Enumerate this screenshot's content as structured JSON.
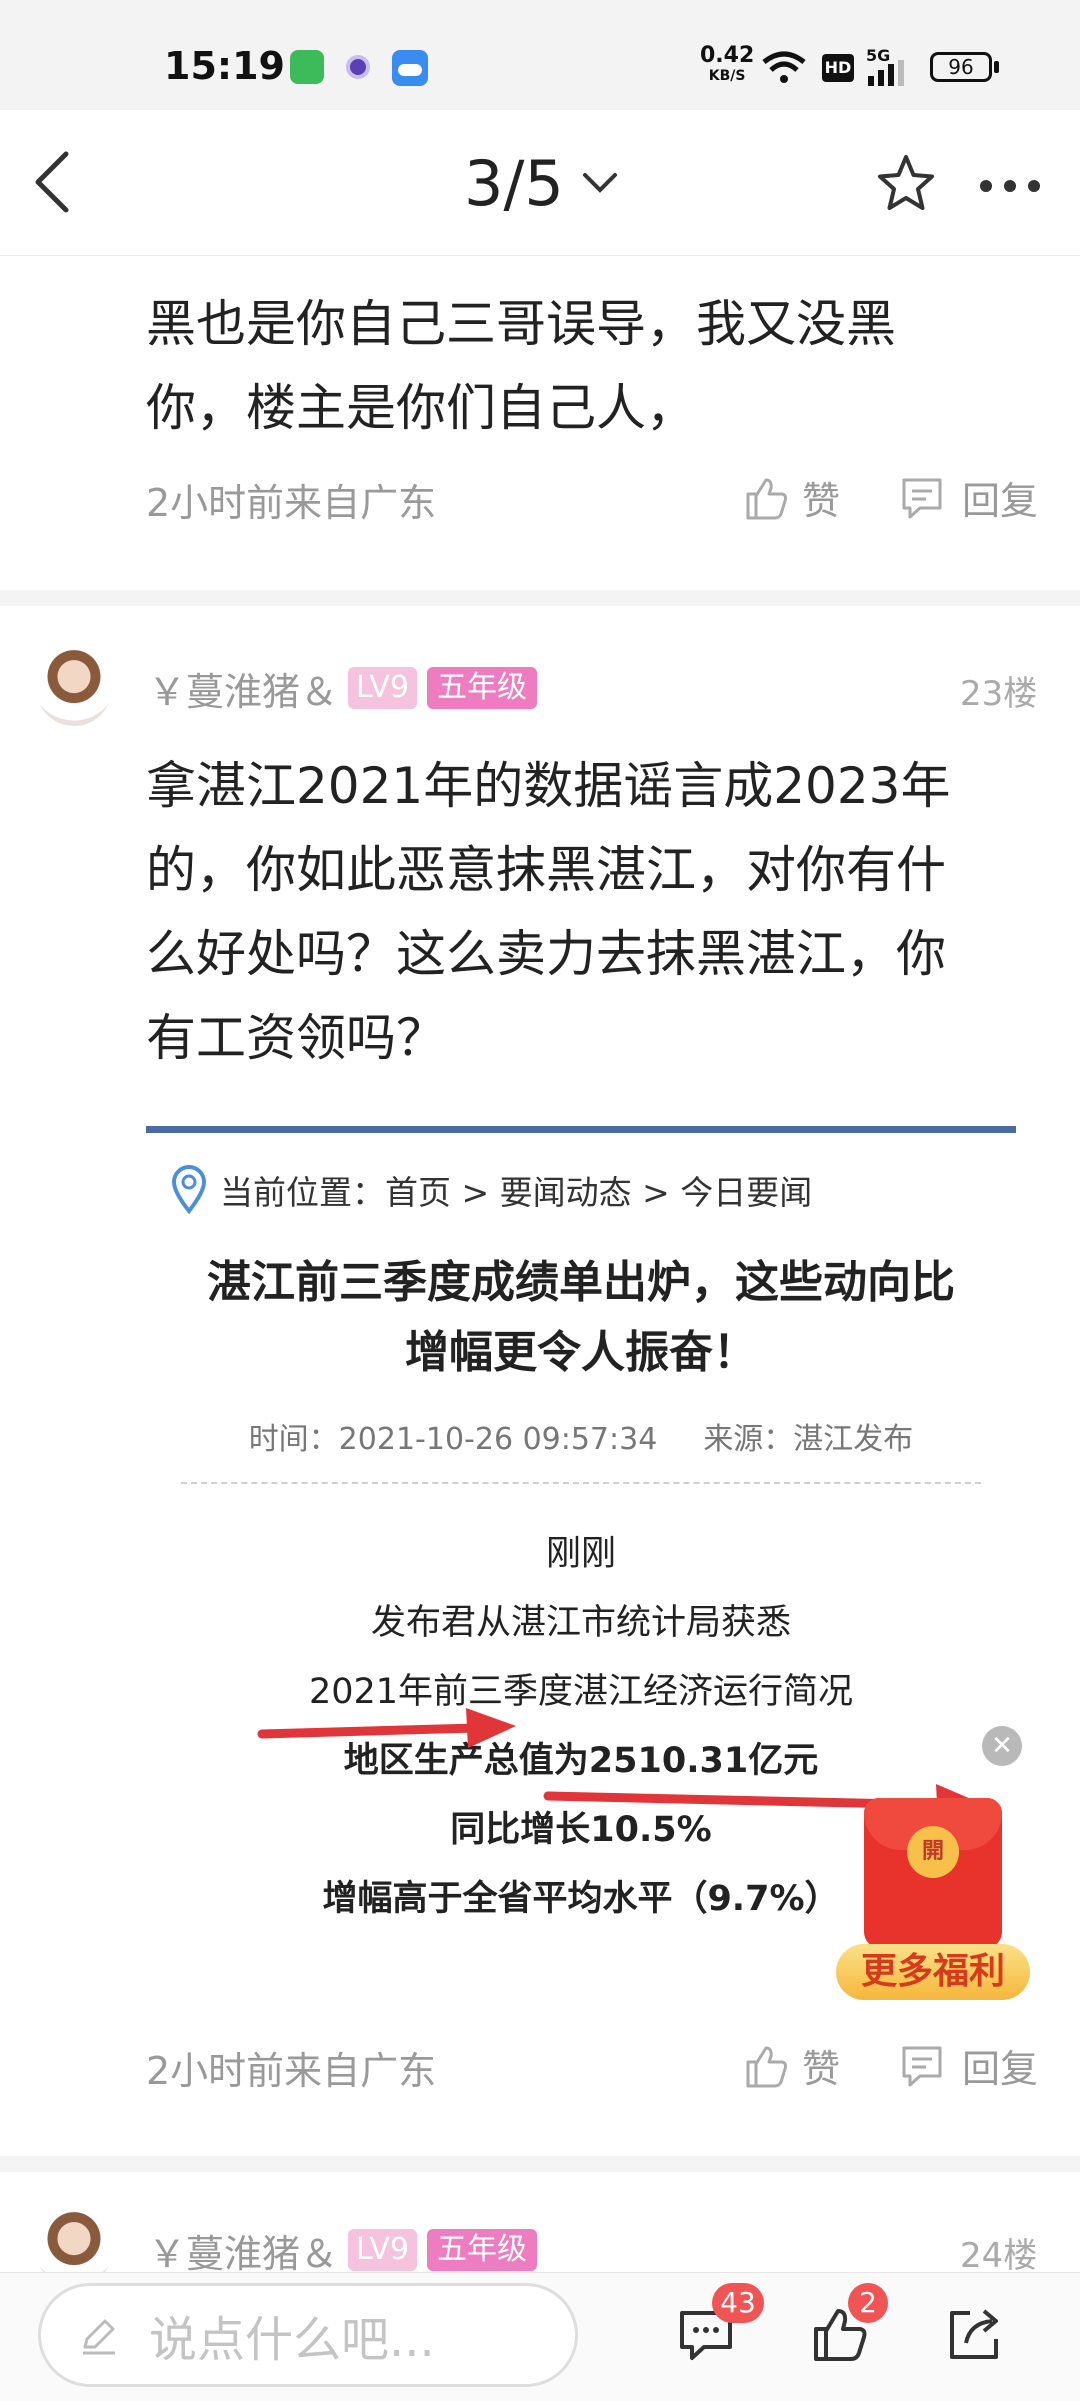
{
  "status_bar": {
    "time": "15:19",
    "speed_value": "0.42",
    "speed_unit": "KB/S",
    "hd": "HD",
    "net": "5G",
    "battery": "96"
  },
  "nav": {
    "page_indicator": "3/5"
  },
  "top_reply": {
    "text_line1": "黑也是你自己三哥误导，我又没黑",
    "text_line2": "你，楼主是你们自己人，",
    "meta": "2小时前来自广东",
    "like_label": "赞",
    "reply_label": "回复"
  },
  "post23": {
    "username": "￥蔓淮猪＆",
    "level": "LV9",
    "grade": "五年级",
    "floor": "23楼",
    "text_lines": [
      "拿湛江2021年的数据谣言成2023年",
      "的，你如此恶意抹黑湛江，对你有什",
      "么好处吗？这么卖力去抹黑湛江，你",
      "有工资领吗？"
    ],
    "meta": "2小时前来自广东",
    "like_label": "赞",
    "reply_label": "回复"
  },
  "screenshot": {
    "breadcrumb": "当前位置：首页 > 要闻动态 > 今日要闻",
    "title_line1": "湛江前三季度成绩单出炉，这些动向比",
    "title_line2": "增幅更令人振奋！",
    "time": "时间：2021-10-26 09:57:34",
    "source": "来源：湛江发布",
    "lines": [
      "刚刚",
      "发布君从湛江市统计局获悉",
      "2021年前三季度湛江经济运行简况",
      "地区生产总值为2510.31亿元",
      "同比增长10.5%",
      "增幅高于全省平均水平（9.7%）"
    ],
    "accent_color": "#4a6aa5",
    "arrow_color": "#e0363a"
  },
  "promo": {
    "open_char": "開",
    "label": "更多福利"
  },
  "post24": {
    "username": "￥蔓淮猪＆",
    "level": "LV9",
    "grade": "五年级",
    "floor": "24楼"
  },
  "bottom_bar": {
    "input_placeholder": "说点什么吧...",
    "comment_count": "43",
    "like_count": "2"
  }
}
